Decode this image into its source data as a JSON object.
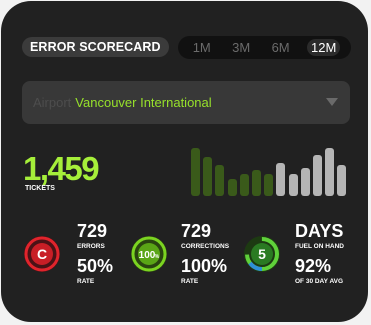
{
  "header": {
    "title": "ERROR SCORECARD",
    "range_tabs": [
      "1M",
      "3M",
      "6M",
      "12M"
    ],
    "active_range": "12M"
  },
  "airport": {
    "label": "Airport",
    "value": "Vancouver International"
  },
  "tickets": {
    "value": "1,459",
    "label": "TICKETS"
  },
  "chart_data": {
    "type": "bar",
    "values": [
      44,
      36,
      28,
      16,
      20,
      24,
      20,
      30,
      20,
      26,
      38,
      44,
      28
    ],
    "colors": [
      "#3a5a1a",
      "#3a5a1a",
      "#3a5a1a",
      "#3a5a1a",
      "#3a5a1a",
      "#3a5a1a",
      "#3a5a1a",
      "#b5b5b5",
      "#b5b5b5",
      "#b5b5b5",
      "#b5b5b5",
      "#b5b5b5",
      "#b5b5b5"
    ]
  },
  "stats": [
    {
      "icon_text": "C",
      "icon": "error-c-icon",
      "accent": "#e0242c",
      "top_value": "729",
      "top_label": "ERRORS",
      "bottom_value": "50%",
      "bottom_label": "RATE"
    },
    {
      "icon_text": "100",
      "icon_suffix": "%",
      "icon": "percent-badge-icon",
      "accent": "#7bd321",
      "top_value": "729",
      "top_label": "CORRECTIONS",
      "bottom_value": "100%",
      "bottom_label": "RATE"
    },
    {
      "icon_text": "5",
      "icon": "fuel-days-gauge-icon",
      "accent": "#5fd13a",
      "top_value": "DAYS",
      "top_label": "FUEL ON HAND",
      "bottom_value": "92%",
      "bottom_label": "OF 30 DAY AVG"
    }
  ]
}
